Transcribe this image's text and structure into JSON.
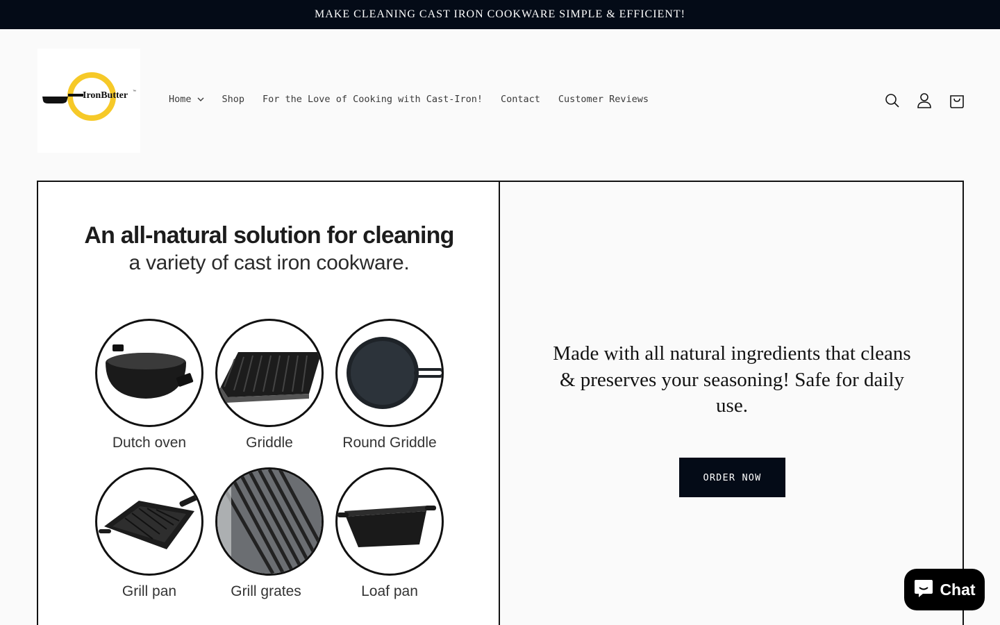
{
  "announcement": {
    "text": "MAKE CLEANING CAST IRON COOKWARE SIMPLE & EFFICIENT!"
  },
  "brand": {
    "logo_text": "IronButter",
    "accent": "#f6c928"
  },
  "nav": {
    "items": [
      {
        "label": "Home",
        "has_dropdown": true
      },
      {
        "label": "Shop"
      },
      {
        "label": "For the Love of Cooking with Cast-Iron!"
      },
      {
        "label": "Contact"
      },
      {
        "label": "Customer Reviews"
      }
    ]
  },
  "header_icons": [
    "search-icon",
    "account-icon",
    "cart-icon"
  ],
  "promo": {
    "title": "An all-natural solution for cleaning",
    "subtitle": "a variety of cast iron cookware.",
    "cookware": [
      {
        "label": "Dutch oven",
        "icon": "dutch-oven-image"
      },
      {
        "label": "Griddle",
        "icon": "griddle-image"
      },
      {
        "label": "Round Griddle",
        "icon": "round-griddle-image"
      },
      {
        "label": "Grill pan",
        "icon": "grill-pan-image"
      },
      {
        "label": "Grill grates",
        "icon": "grill-grates-image"
      },
      {
        "label": "Loaf pan",
        "icon": "loaf-pan-image"
      }
    ]
  },
  "hero": {
    "tagline": "Made with all natural ingredients that cleans & preserves your seasoning! Safe for daily use.",
    "cta_label": "ORDER NOW"
  },
  "chat": {
    "label": "Chat"
  },
  "colors": {
    "dark": "#040b17",
    "background": "#fafafa",
    "border": "#121212"
  }
}
